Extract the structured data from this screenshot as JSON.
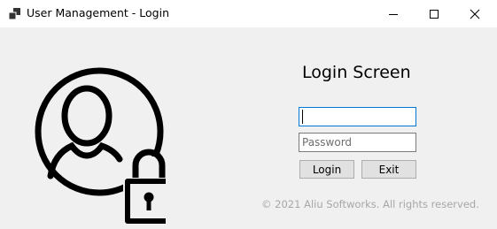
{
  "window": {
    "title": "User Management - Login",
    "controls": [
      "minimize",
      "maximize",
      "close"
    ]
  },
  "icons": {
    "app": "app-window-icon",
    "graphic": "user-lock-icon"
  },
  "login": {
    "heading": "Login Screen",
    "username": {
      "value": "",
      "placeholder": ""
    },
    "password": {
      "value": "",
      "placeholder": "Password"
    },
    "login_label": "Login",
    "exit_label": "Exit"
  },
  "footer": {
    "copyright": "© 2021 Aliu Softworks. All rights reserved."
  },
  "colors": {
    "focus_border": "#0078d7",
    "footer_text": "#a7a7a7",
    "background": "#f0f0f0"
  }
}
